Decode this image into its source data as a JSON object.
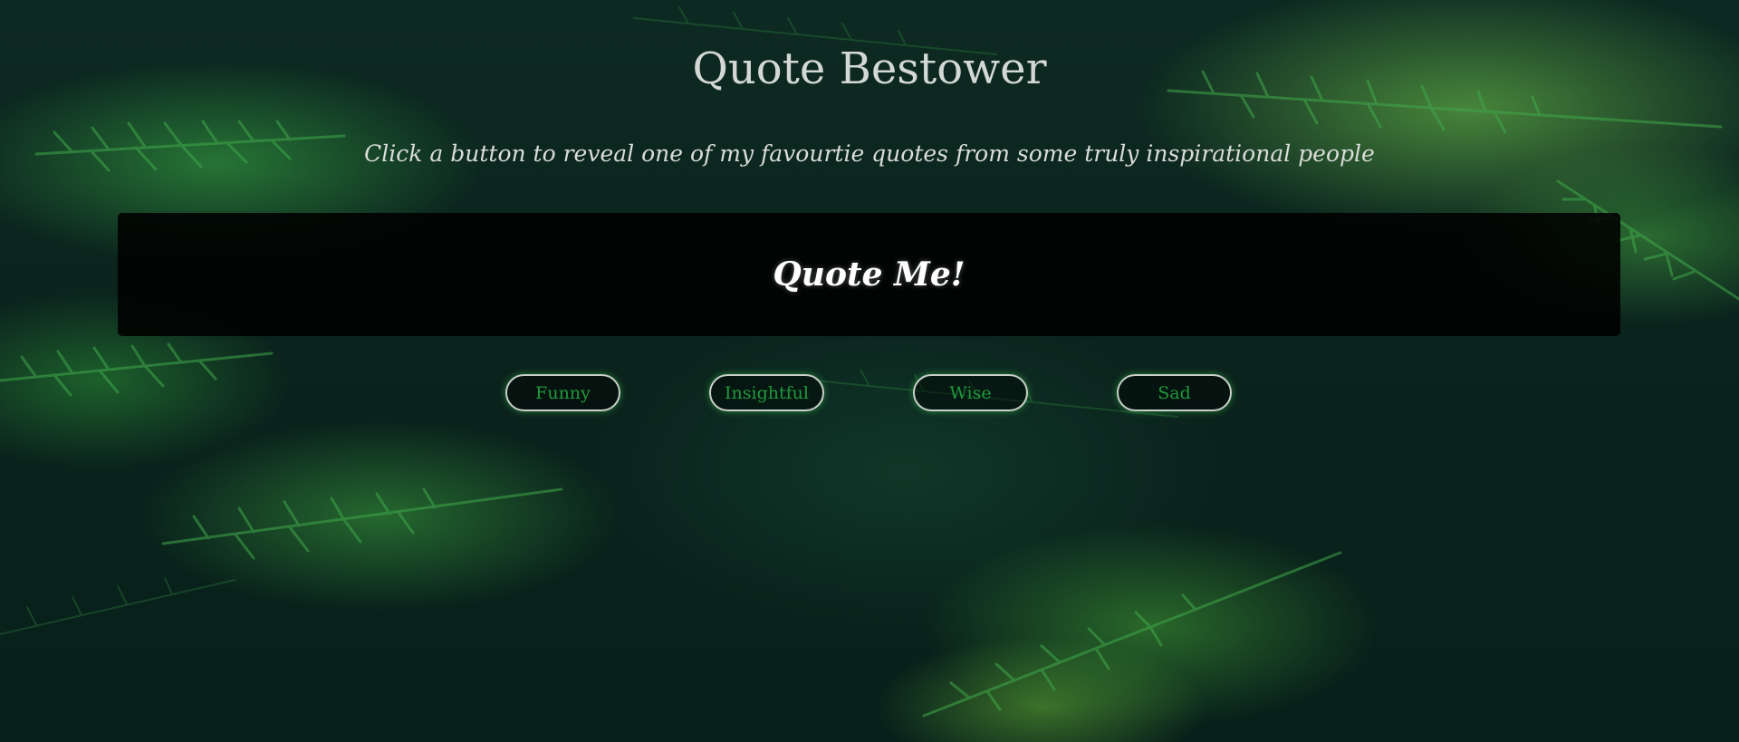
{
  "page": {
    "title": "Quote Bestower",
    "subtitle": "Click a button to reveal one of my favourtie quotes from some truly inspirational people"
  },
  "quote_box": {
    "text": "Quote Me!"
  },
  "buttons": [
    {
      "label": "Funny"
    },
    {
      "label": "Insightful"
    },
    {
      "label": "Wise"
    },
    {
      "label": "Sad"
    }
  ],
  "colors": {
    "button_text": "#1f9a3c",
    "button_border": "#c9cfc9",
    "title_text": "#d4d8d4",
    "quote_box_bg": "#000000",
    "background": "#0a1e18"
  }
}
